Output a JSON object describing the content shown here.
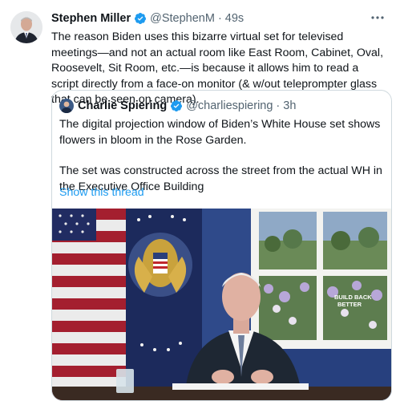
{
  "tweet": {
    "author_name": "Stephen Miller",
    "author_handle": "@StephenM",
    "separator": "·",
    "time": "49s",
    "more_icon": "more-horizontal-icon",
    "text": "The reason Biden uses this bizarre virtual set for televised meetings—and not an actual room like East Room, Cabinet, Oval, Roosevelt, Sit Room, etc.—is because it allows him to read a script directly from a face-on monitor (& w/out teleprompter glass that can be seen on camera)."
  },
  "quote": {
    "author_name": "Charlie Spiering",
    "author_handle": "@charliespiering",
    "separator": "·",
    "time": "3h",
    "paragraph1": "The digital projection window of Biden’s White House set shows flowers in bloom in the Rose Garden.",
    "paragraph2": "The set was constructed across the street from the actual WH in the Executive Office Building",
    "show_thread": "Show this thread",
    "media": {
      "banner_line1": "BUILD BACK",
      "banner_line2": "BETTER"
    }
  },
  "colors": {
    "accent": "#1d9bf0",
    "secondary_text": "#536471",
    "border": "#cfd9de"
  }
}
